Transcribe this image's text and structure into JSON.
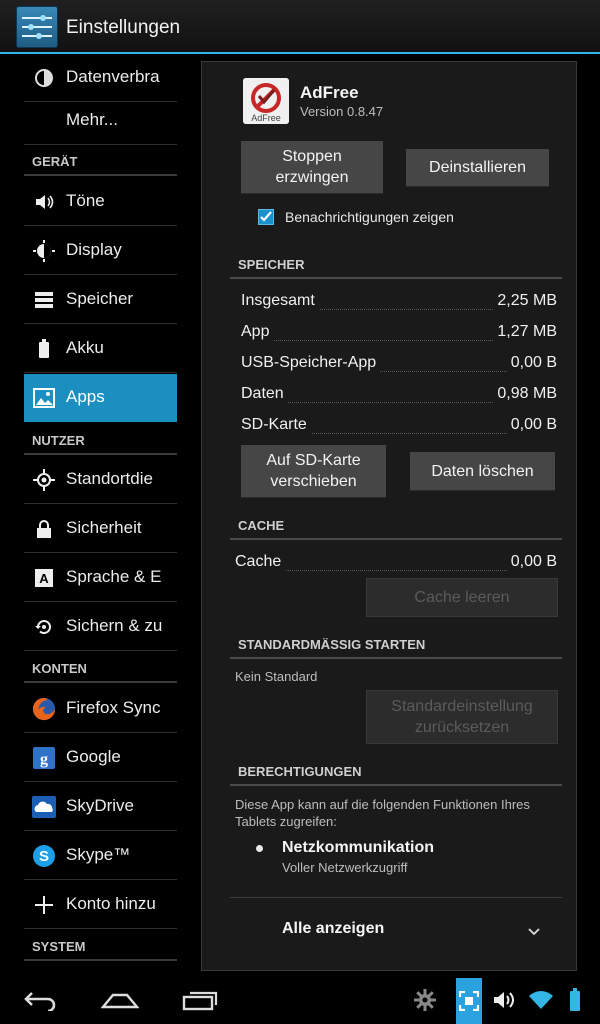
{
  "header": {
    "title": "Einstellungen"
  },
  "left": {
    "items_top": [
      {
        "label": "Datenverbra",
        "icon": "data-usage-icon"
      },
      {
        "label": "Mehr...",
        "icon": ""
      }
    ],
    "sections": [
      {
        "header": "GERÄT",
        "items": [
          {
            "label": "Töne",
            "icon": "speaker-icon"
          },
          {
            "label": "Display",
            "icon": "brightness-icon"
          },
          {
            "label": "Speicher",
            "icon": "storage-icon"
          },
          {
            "label": "Akku",
            "icon": "battery-icon"
          },
          {
            "label": "Apps",
            "icon": "apps-icon",
            "active": true
          }
        ]
      },
      {
        "header": "NUTZER",
        "items": [
          {
            "label": "Standortdie",
            "icon": "location-icon"
          },
          {
            "label": "Sicherheit",
            "icon": "lock-icon"
          },
          {
            "label": "Sprache & E",
            "icon": "language-icon"
          },
          {
            "label": "Sichern & zu",
            "icon": "backup-icon"
          }
        ]
      },
      {
        "header": "KONTEN",
        "items": [
          {
            "label": "Firefox Sync",
            "icon": "firefox-icon"
          },
          {
            "label": "Google",
            "icon": "google-icon"
          },
          {
            "label": "SkyDrive",
            "icon": "skydrive-icon"
          },
          {
            "label": "Skype™",
            "icon": "skype-icon"
          },
          {
            "label": "Konto hinzu",
            "icon": "plus-icon"
          }
        ]
      },
      {
        "header": "SYSTEM",
        "items": []
      }
    ]
  },
  "app": {
    "name": "AdFree",
    "version": "Version 0.8.47",
    "icon_text": "AdFree",
    "force_stop": "Stoppen erzwingen",
    "uninstall": "Deinstallieren",
    "notifications_label": "Benachrichtigungen zeigen",
    "notifications_checked": true
  },
  "storage": {
    "header": "SPEICHER",
    "rows": [
      {
        "label": "Insgesamt",
        "value": "2,25 MB"
      },
      {
        "label": "App",
        "value": "1,27 MB"
      },
      {
        "label": "USB-Speicher-App",
        "value": "0,00 B"
      },
      {
        "label": "Daten",
        "value": "0,98 MB"
      },
      {
        "label": "SD-Karte",
        "value": "0,00 B"
      }
    ],
    "move_button": "Auf SD-Karte verschieben",
    "clear_button": "Daten löschen"
  },
  "cache": {
    "header": "CACHE",
    "label": "Cache",
    "value": "0,00 B",
    "clear_button": "Cache leeren"
  },
  "launch": {
    "header": "STANDARDMÄSSIG STARTEN",
    "text": "Kein Standard",
    "reset_button": "Standardeinstellung zurücksetzen"
  },
  "permissions": {
    "header": "BERECHTIGUNGEN",
    "intro": "Diese App kann auf die folgenden Funktionen Ihres Tablets zugreifen:",
    "item_title": "Netzkommunikation",
    "item_sub": "Voller Netzwerkzugriff",
    "show_all": "Alle anzeigen"
  },
  "colors": {
    "accent": "#33b5e5",
    "active_row": "#1c8fc1"
  }
}
